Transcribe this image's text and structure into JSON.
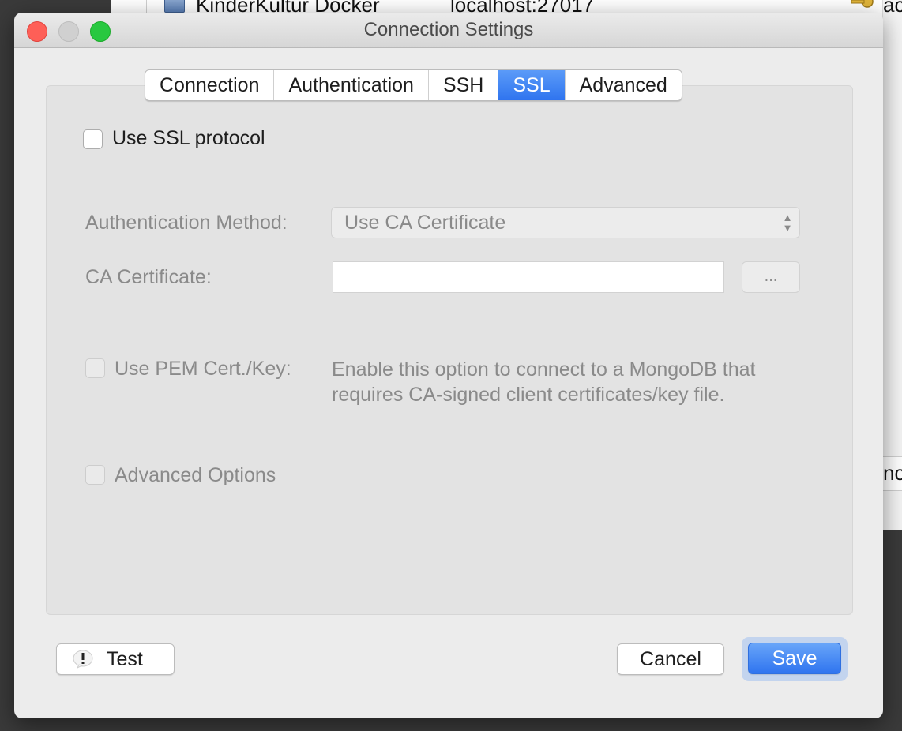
{
  "background_window": {
    "row_name": "KinderKultur Docker",
    "row_address": "localhost:27017",
    "row_right_fragment": "ac",
    "side_fragment": "nc"
  },
  "dialog": {
    "title": "Connection Settings",
    "tabs": [
      {
        "label": "Connection",
        "active": false
      },
      {
        "label": "Authentication",
        "active": false
      },
      {
        "label": "SSH",
        "active": false
      },
      {
        "label": "SSL",
        "active": true
      },
      {
        "label": "Advanced",
        "active": false
      }
    ],
    "ssl": {
      "use_ssl_label": "Use SSL protocol",
      "use_ssl_checked": false,
      "auth_method_label": "Authentication Method:",
      "auth_method_value": "Use CA Certificate",
      "ca_cert_label": "CA Certificate:",
      "ca_cert_value": "",
      "browse_label": "...",
      "use_pem_label": "Use PEM Cert./Key:",
      "use_pem_hint_line1": "Enable this option to connect to a MongoDB that",
      "use_pem_hint_line2": "requires CA-signed client certificates/key file.",
      "advanced_options_label": "Advanced Options"
    },
    "buttons": {
      "test": "Test",
      "cancel": "Cancel",
      "save": "Save"
    }
  },
  "colors": {
    "accent": "#2f74ef",
    "close": "#fe5f57",
    "maximize": "#28c840",
    "disabled_text": "#8a8a8a"
  }
}
